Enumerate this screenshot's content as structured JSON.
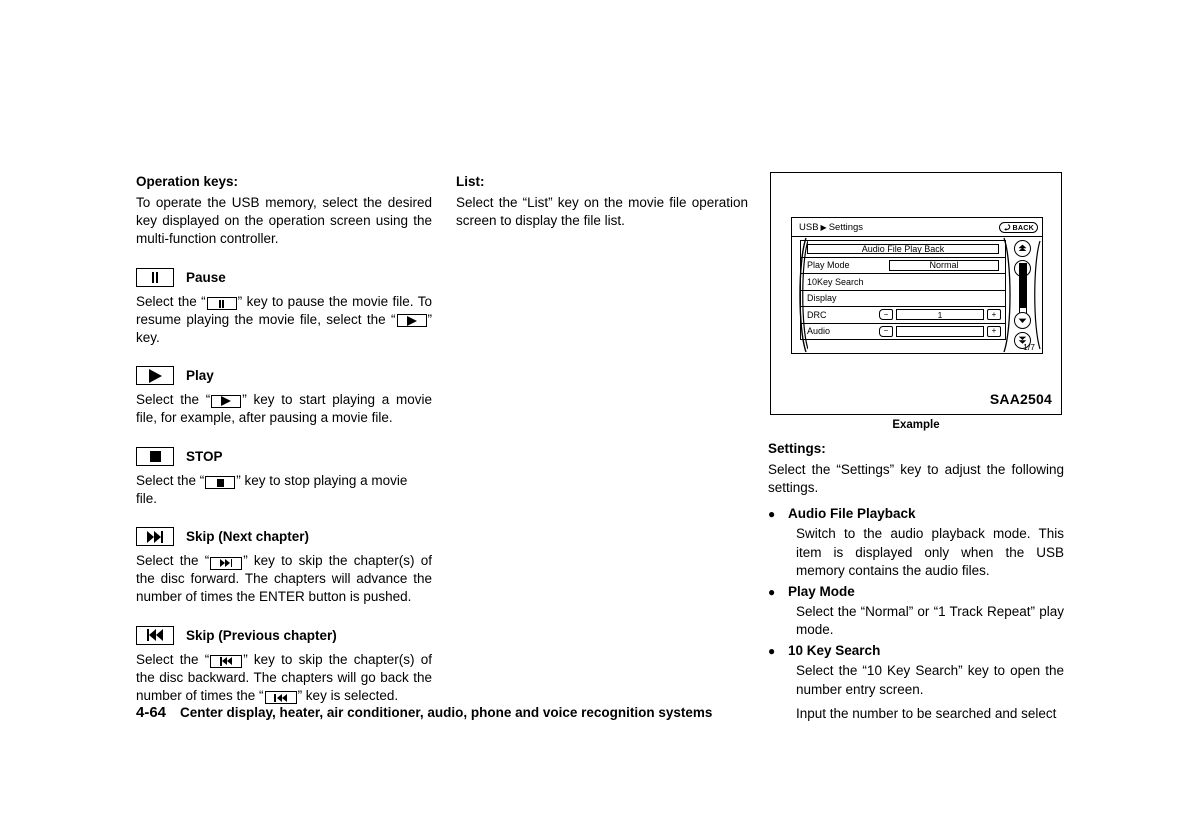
{
  "left_column": {
    "heading": "Operation keys:",
    "intro": "To operate the USB memory, select the desired key displayed on the operation screen using the multi-function controller.",
    "keys": [
      {
        "icon": "pause-icon",
        "label": "Pause",
        "description_pre": "Select the “",
        "description_mid": "” key to pause the movie file. To resume playing the movie file, select the “",
        "description_post": "” key."
      },
      {
        "icon": "play-icon",
        "label": "Play",
        "description": "Select the “",
        "description_post": "” key to start playing a movie file, for example, after pausing a movie file."
      },
      {
        "icon": "stop-icon",
        "label": "STOP",
        "description": "Select the “",
        "description_post": "” key to stop playing a movie file."
      },
      {
        "icon": "skip-next-icon",
        "label": "Skip (Next chapter)",
        "description": "Select the “",
        "description_post": "” key to skip the chapter(s) of the disc forward. The chapters will advance the number of times the ENTER button is pushed."
      },
      {
        "icon": "skip-previous-icon",
        "label": "Skip (Previous chapter)",
        "description": "Select the “",
        "description_mid": "” key to skip the chapter(s) of the disc backward. The chapters will go back the number of times the “",
        "description_post": "” key is selected."
      }
    ]
  },
  "middle_column": {
    "heading": "List:",
    "body": "Select the “List” key on the movie file operation screen to display the file list."
  },
  "figure": {
    "caption": "Example",
    "code": "SAA2504",
    "screen": {
      "title": "USB",
      "title_arrow": "▶",
      "title_sub": "Settings",
      "back_button": "BACK",
      "page_indicator": "1/7",
      "rows": [
        {
          "type": "center-button",
          "label": "Audio File Play Back"
        },
        {
          "type": "value",
          "label": "Play Mode",
          "value": "Normal"
        },
        {
          "type": "plain",
          "label": "10Key Search"
        },
        {
          "type": "plain",
          "label": "Display"
        },
        {
          "type": "stepper",
          "label": "DRC",
          "value": "1",
          "minus": "−",
          "plus": "+"
        },
        {
          "type": "stepper",
          "label": "Audio",
          "value": "",
          "minus": "−",
          "plus": "+"
        }
      ],
      "scroll_buttons": [
        "scroll-top-icon",
        "scroll-up-icon",
        "scroll-down-icon",
        "scroll-bottom-icon"
      ]
    }
  },
  "right_column": {
    "heading": "Settings:",
    "intro": "Select the “Settings” key to adjust the following settings.",
    "bullets": [
      {
        "title": "Audio File Playback",
        "paragraphs": [
          "Switch to the audio playback mode. This item is displayed only when the USB memory contains the audio files."
        ]
      },
      {
        "title": "Play Mode",
        "paragraphs": [
          "Select the “Normal” or “1 Track Repeat” play mode."
        ]
      },
      {
        "title": "10 Key Search",
        "paragraphs": [
          "Select the “10 Key Search” key to open the number entry screen.",
          "Input the number to be searched and select"
        ]
      }
    ]
  },
  "footer": {
    "page_number": "4-64",
    "chapter_title": "Center display, heater, air conditioner, audio, phone and voice recognition systems"
  }
}
